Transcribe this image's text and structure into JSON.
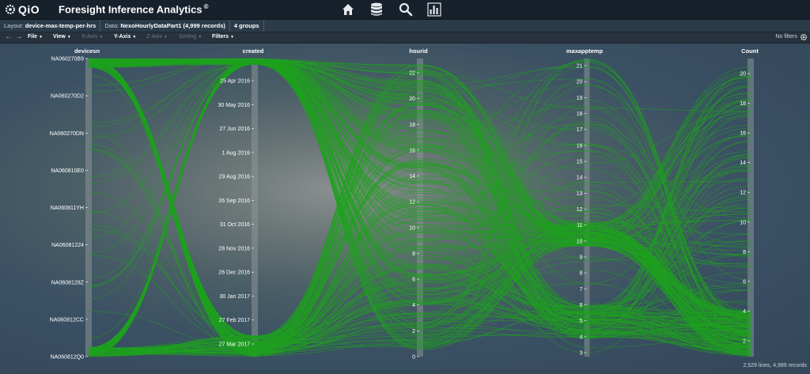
{
  "app": {
    "logo_text": "QiO",
    "title": "Foresight Inference Analytics",
    "title_mark": "®",
    "nav_icons": [
      "home-icon",
      "database-icon",
      "search-icon",
      "bar-chart-icon"
    ]
  },
  "info": {
    "layout_label": "Layout:",
    "layout_value": "device-max-temp-per-hrs",
    "data_label": "Data:",
    "data_value": "NexoHourlyDataPart1 (4,999 records)",
    "groups": "4 groups"
  },
  "toolbar": {
    "file": "File",
    "view": "View",
    "xaxis": "X-Axis",
    "yaxis": "Y-Axis",
    "zaxis": "Z-Axis",
    "sorting": "Sorting",
    "filters": "Filters",
    "no_filters": "No filters"
  },
  "status": "2,529 lines, 4,999 records",
  "colors": {
    "line": "#1fa11f",
    "axis_bar": "#8d9497",
    "accent": "#ffffff"
  },
  "chart_data": {
    "type": "parallel-coordinates",
    "axes": [
      {
        "name": "devicesn",
        "ticks": [
          "NA060270B9",
          "NA060270D2",
          "NA060270DN",
          "NA060810E0",
          "NA060811YH",
          "NA06081224",
          "NA0608128Z",
          "NA060812CC",
          "NA060812Q0"
        ]
      },
      {
        "name": "created",
        "ticks": [
          "25 Apr 2016",
          "30 May 2016",
          "27 Jun 2016",
          "1 Aug 2016",
          "29 Aug 2016",
          "26 Sep 2016",
          "31 Oct 2016",
          "28 Nov 2016",
          "26 Dec 2016",
          "30 Jan 2017",
          "27 Feb 2017",
          "27 Mar 2017"
        ]
      },
      {
        "name": "hourid",
        "ticks": [
          "0",
          "2",
          "4",
          "6",
          "8",
          "10",
          "12",
          "14",
          "16",
          "18",
          "20",
          "22"
        ]
      },
      {
        "name": "maxapptemp",
        "ticks": [
          "3",
          "4",
          "5",
          "6",
          "7",
          "8",
          "9",
          "10",
          "11",
          "12",
          "13",
          "14",
          "15",
          "16",
          "17",
          "18",
          "19",
          "20",
          "21"
        ]
      },
      {
        "name": "Count",
        "ticks": [
          "2",
          "4",
          "6",
          "8",
          "10",
          "12",
          "14",
          "16",
          "18",
          "20"
        ]
      }
    ]
  }
}
